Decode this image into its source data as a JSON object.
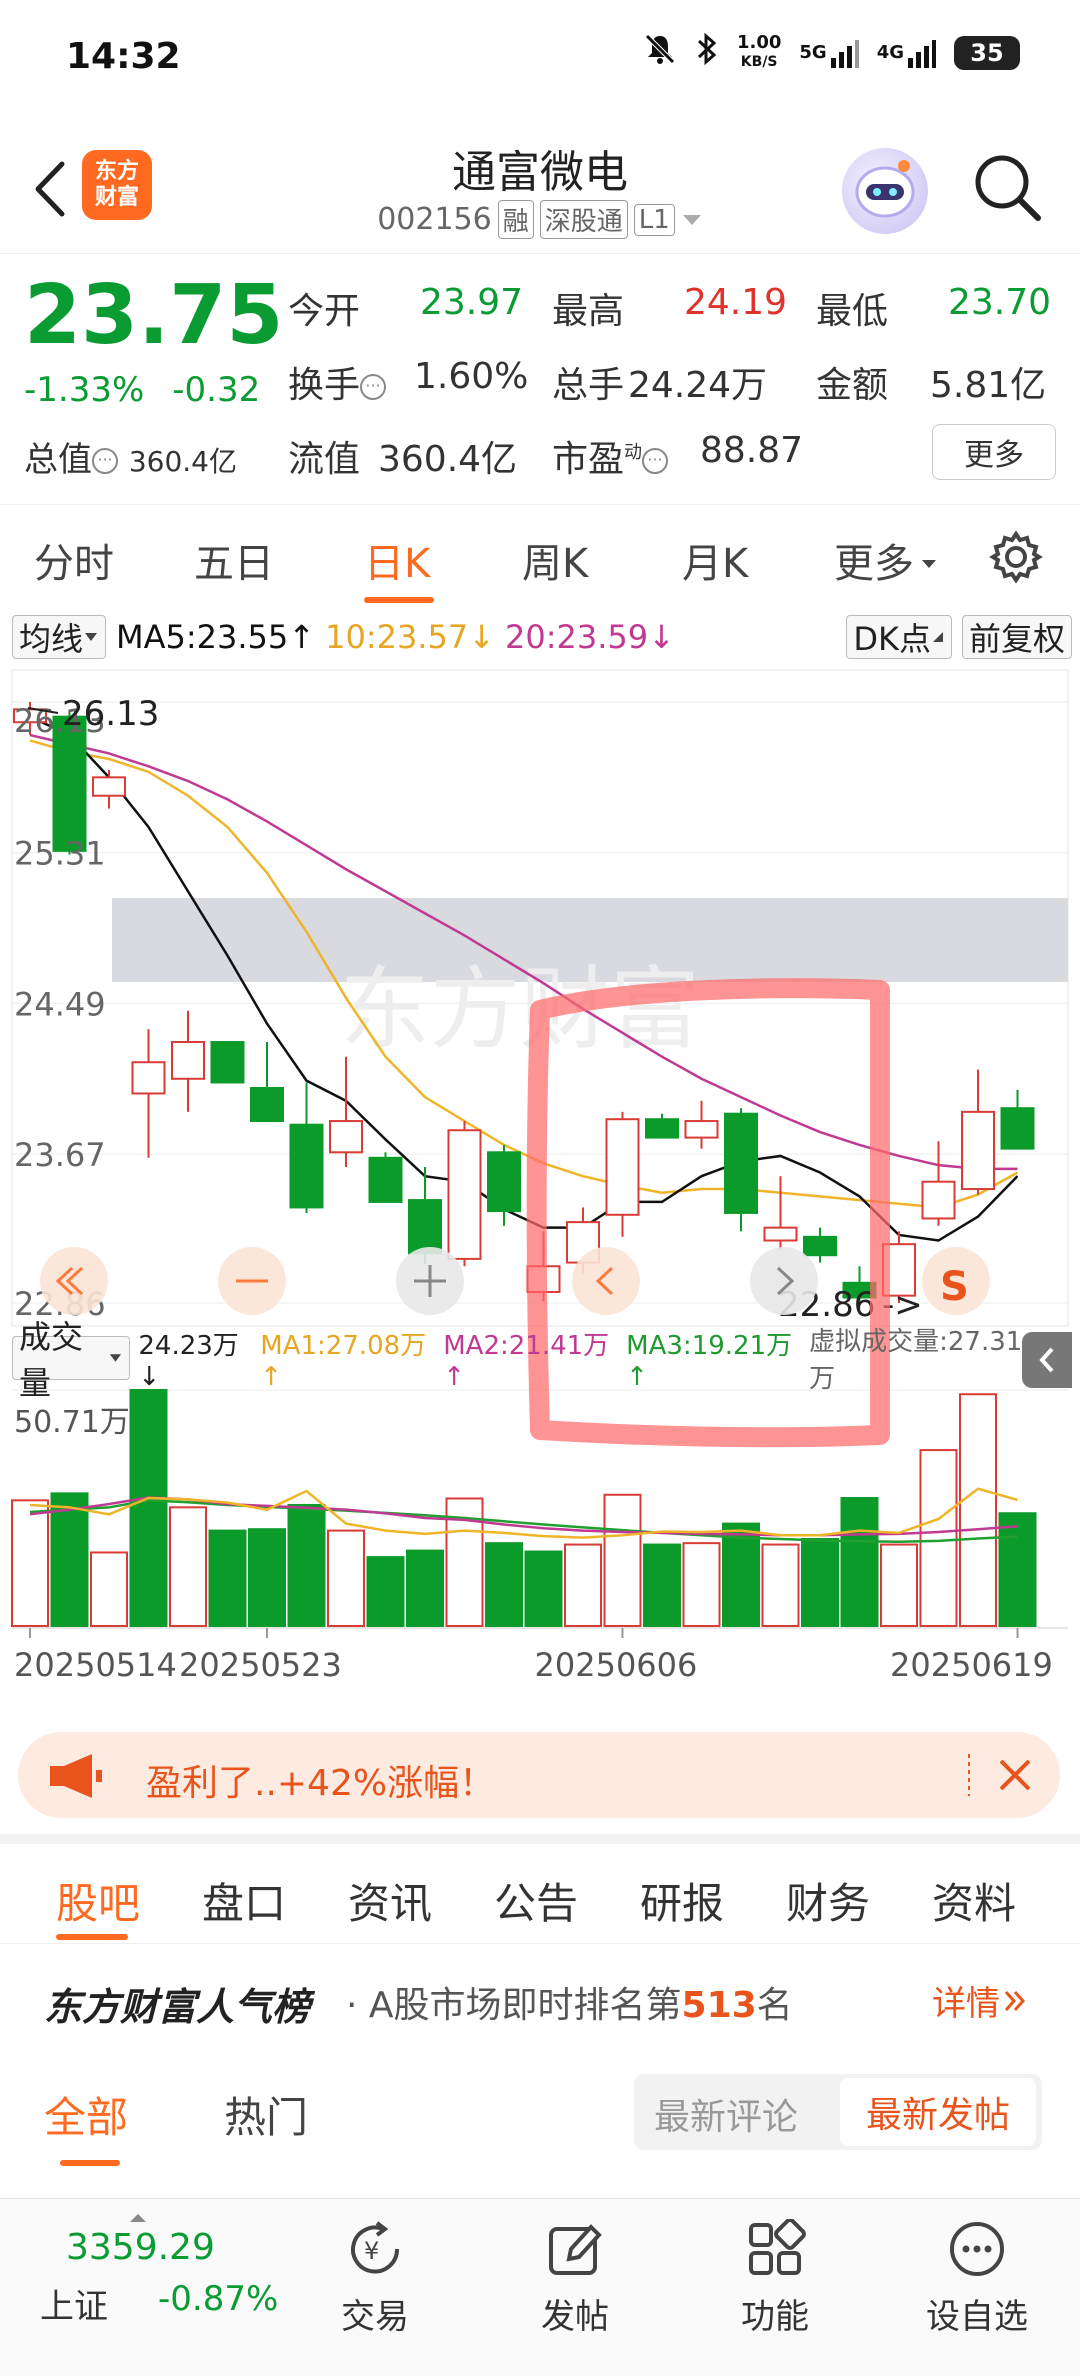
{
  "status_bar": {
    "time": "14:32",
    "net_speed_value": "1.00",
    "net_speed_unit": "KB/S",
    "sig1": "5G",
    "sig2": "4G",
    "battery": "35"
  },
  "header": {
    "logo_line1": "东方",
    "logo_line2": "财富",
    "stock_name": "通富微电",
    "stock_code": "002156",
    "tag_margin": "融",
    "tag_connect": "深股通",
    "tag_level": "L1"
  },
  "quote": {
    "price": "23.75",
    "change_pct": "-1.33%",
    "change_abs": "-0.32",
    "total_cap_label": "总值",
    "total_cap_value": "360.4亿",
    "open_label": "今开",
    "open_value": "23.97",
    "high_label": "最高",
    "high_value": "24.19",
    "low_label": "最低",
    "low_value": "23.70",
    "turnover_label": "换手",
    "turnover_value": "1.60%",
    "volume_label": "总手",
    "volume_value": "24.24万",
    "amount_label": "金额",
    "amount_value": "5.81亿",
    "float_cap_label": "流值",
    "float_cap_value": "360.4亿",
    "pe_label": "市盈",
    "pe_sup": "动",
    "pe_value": "88.87",
    "more_button": "更多"
  },
  "period_tabs": [
    "分时",
    "五日",
    "日K",
    "周K",
    "月K",
    "更多"
  ],
  "ma_row": {
    "selector": "均线",
    "ma5": "MA5:23.55↑",
    "ma10": "10:23.57↓",
    "ma20": "20:23.59↓",
    "dk_button": "DK点",
    "adjust_button": "前复权"
  },
  "volume_header": {
    "selector": "成交量",
    "vol": "24.23万↓",
    "ma1": "MA1:27.08万↑",
    "ma2": "MA2:21.41万↑",
    "ma3": "MA3:19.21万↑",
    "virtual": "虚拟成交量:27.31万",
    "max_label": "50.71万"
  },
  "chart_data": {
    "type": "candlestick",
    "y_axis_ticks": [
      "26.13",
      "25.31",
      "24.49",
      "23.67",
      "22.86"
    ],
    "ylim": [
      22.86,
      26.13
    ],
    "x_tick_labels": [
      "20250514",
      "20250523",
      "20250606",
      "20250619"
    ],
    "high_annotation": "26.13",
    "low_annotation": "22.86",
    "colors": {
      "up": "#d93b35",
      "down": "#0b9b2a",
      "ma5": "#111111",
      "ma10": "#f0b429",
      "ma20": "#c03a93",
      "vol_ma1": "#f0b429",
      "vol_ma2": "#c03a93",
      "vol_ma3": "#20a030"
    },
    "candles": [
      {
        "open": 26.02,
        "high": 26.13,
        "low": 25.95,
        "close": 26.09
      },
      {
        "open": 26.05,
        "high": 26.08,
        "low": 25.3,
        "close": 25.32
      },
      {
        "open": 25.62,
        "high": 25.76,
        "low": 25.55,
        "close": 25.72
      },
      {
        "open": 24.0,
        "high": 24.35,
        "low": 23.65,
        "close": 24.17
      },
      {
        "open": 24.08,
        "high": 24.45,
        "low": 23.9,
        "close": 24.28
      },
      {
        "open": 24.28,
        "high": 24.28,
        "low": 24.06,
        "close": 24.06
      },
      {
        "open": 24.03,
        "high": 24.28,
        "low": 23.9,
        "close": 23.85
      },
      {
        "open": 23.83,
        "high": 24.06,
        "low": 23.35,
        "close": 23.38
      },
      {
        "open": 23.68,
        "high": 24.2,
        "low": 23.6,
        "close": 23.85
      },
      {
        "open": 23.65,
        "high": 23.68,
        "low": 23.42,
        "close": 23.41
      },
      {
        "open": 23.42,
        "high": 23.6,
        "low": 23.07,
        "close": 23.13
      },
      {
        "open": 23.1,
        "high": 23.85,
        "low": 23.06,
        "close": 23.8
      },
      {
        "open": 23.68,
        "high": 23.72,
        "low": 23.28,
        "close": 23.36
      },
      {
        "open": 22.92,
        "high": 23.25,
        "low": 22.87,
        "close": 23.06
      },
      {
        "open": 23.08,
        "high": 23.38,
        "low": 23.02,
        "close": 23.3
      },
      {
        "open": 23.34,
        "high": 23.9,
        "low": 23.22,
        "close": 23.86
      },
      {
        "open": 23.86,
        "high": 23.89,
        "low": 23.76,
        "close": 23.76
      },
      {
        "open": 23.76,
        "high": 23.96,
        "low": 23.7,
        "close": 23.85
      },
      {
        "open": 23.89,
        "high": 23.92,
        "low": 23.25,
        "close": 23.35
      },
      {
        "open": 23.2,
        "high": 23.55,
        "low": 23.15,
        "close": 23.27
      },
      {
        "open": 23.22,
        "high": 23.27,
        "low": 23.08,
        "close": 23.12
      },
      {
        "open": 22.97,
        "high": 23.06,
        "low": 22.86,
        "close": 22.89
      },
      {
        "open": 22.9,
        "high": 23.25,
        "low": 22.86,
        "close": 23.18
      },
      {
        "open": 23.32,
        "high": 23.74,
        "low": 23.28,
        "close": 23.52
      },
      {
        "open": 23.48,
        "high": 24.13,
        "low": 23.45,
        "close": 23.9
      },
      {
        "open": 23.92,
        "high": 24.02,
        "low": 23.7,
        "close": 23.7
      }
    ],
    "ma5": [
      26.05,
      25.95,
      25.72,
      25.45,
      25.1,
      24.75,
      24.38,
      24.07,
      23.96,
      23.75,
      23.55,
      23.52,
      23.37,
      23.27,
      23.27,
      23.41,
      23.41,
      23.55,
      23.63,
      23.66,
      23.57,
      23.44,
      23.23,
      23.2,
      23.33,
      23.55
    ],
    "ma10": [
      25.92,
      25.86,
      25.82,
      25.75,
      25.62,
      25.45,
      25.2,
      24.88,
      24.52,
      24.2,
      23.98,
      23.85,
      23.72,
      23.62,
      23.55,
      23.5,
      23.46,
      23.48,
      23.48,
      23.46,
      23.44,
      23.42,
      23.4,
      23.38,
      23.45,
      23.57
    ],
    "ma20": [
      25.95,
      25.9,
      25.85,
      25.78,
      25.7,
      25.6,
      25.48,
      25.35,
      25.22,
      25.1,
      24.98,
      24.86,
      24.73,
      24.6,
      24.46,
      24.33,
      24.2,
      24.08,
      23.98,
      23.88,
      23.79,
      23.72,
      23.66,
      23.61,
      23.59,
      23.59
    ],
    "volumes": [
      27.0,
      28.5,
      15.8,
      50.71,
      25.5,
      20.5,
      20.8,
      26.0,
      20.5,
      14.8,
      16.2,
      27.4,
      17.8,
      16.0,
      17.5,
      28.2,
      17.5,
      17.8,
      22.0,
      17.5,
      18.7,
      27.5,
      17.5,
      37.8,
      49.8,
      24.23
    ],
    "vol_up": [
      true,
      false,
      true,
      false,
      true,
      false,
      false,
      false,
      true,
      false,
      false,
      true,
      false,
      false,
      true,
      true,
      false,
      true,
      false,
      true,
      false,
      false,
      true,
      true,
      true,
      false
    ],
    "vol_ma1": [
      26.0,
      25.5,
      24.0,
      27.5,
      27.2,
      26.5,
      25.0,
      29.0,
      22.0,
      20.5,
      19.8,
      20.5,
      20.0,
      19.3,
      19.0,
      19.5,
      20.3,
      20.2,
      20.5,
      19.5,
      19.5,
      20.5,
      20.0,
      23.0,
      29.5,
      27.08
    ],
    "vol_ma2": [
      24.0,
      25.0,
      26.2,
      27.6,
      27.2,
      26.2,
      25.8,
      25.4,
      25.0,
      24.2,
      23.2,
      22.8,
      21.8,
      21.0,
      20.5,
      20.2,
      20.0,
      19.8,
      19.7,
      19.5,
      19.5,
      19.7,
      19.8,
      20.2,
      20.8,
      21.41
    ],
    "vol_ma3": [
      24.5,
      25.0,
      25.5,
      27.0,
      26.6,
      26.0,
      25.6,
      25.2,
      24.8,
      24.3,
      23.8,
      23.2,
      22.5,
      21.8,
      21.2,
      20.6,
      20.0,
      19.5,
      19.0,
      18.7,
      18.4,
      18.2,
      18.1,
      18.3,
      18.8,
      19.21
    ],
    "vol_max": 50.71
  },
  "promo": {
    "text": "盈利了..+42%涨幅！"
  },
  "content_tabs": [
    "股吧",
    "盘口",
    "资讯",
    "公告",
    "研报",
    "财务",
    "资料"
  ],
  "popularity": {
    "brand": "东方财富人气榜",
    "text_prefix": "· A股市场即时排名第",
    "rank": "513",
    "text_suffix": "名",
    "detail": "详情"
  },
  "filter_tabs": [
    "全部",
    "热门"
  ],
  "sort_toggle": {
    "latest_comment": "最新评论",
    "latest_post": "最新发帖"
  },
  "bottom_nav": {
    "index_value": "3359.29",
    "index_name": "上证",
    "index_change": "-0.87%",
    "items": [
      "交易",
      "发帖",
      "功能",
      "设自选"
    ]
  }
}
